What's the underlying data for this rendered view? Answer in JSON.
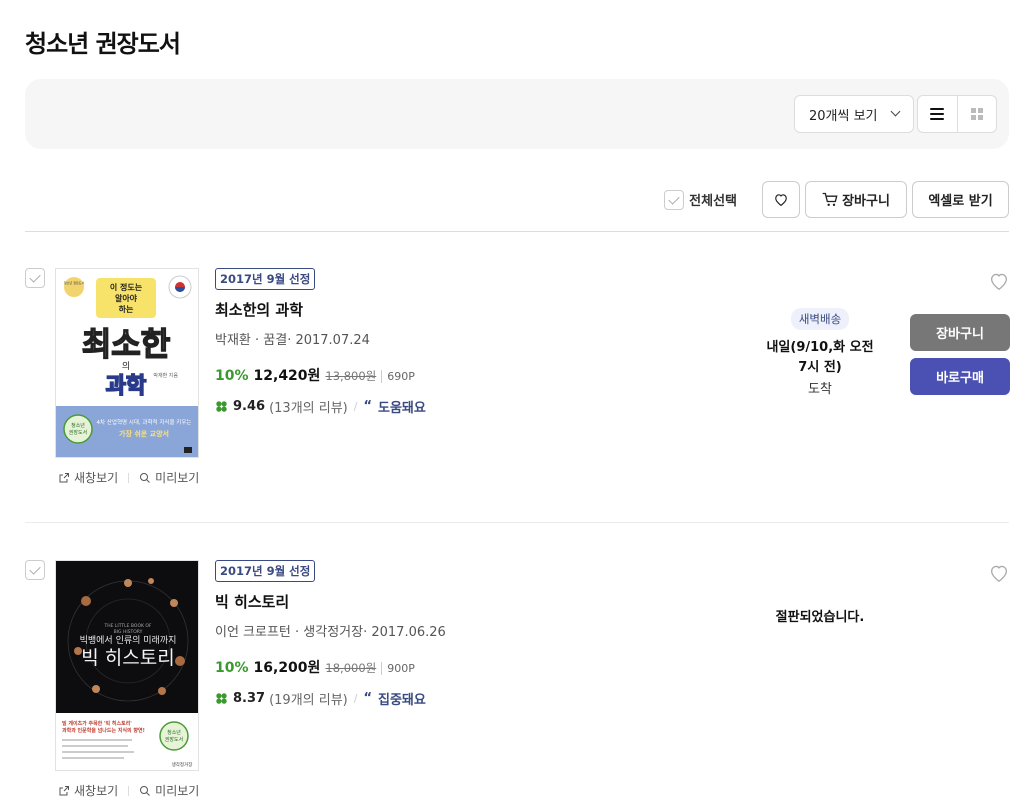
{
  "page": {
    "title": "청소년 권장도서"
  },
  "toolbar": {
    "per_page": "20개씩 보기",
    "view_list_icon": "list-view-icon",
    "view_grid_icon": "grid-view-icon"
  },
  "actions": {
    "select_all": "전체선택",
    "cart": "장바구니",
    "excel": "엑셀로 받기"
  },
  "cover_links": {
    "new_window": "새창보기",
    "preview": "미리보기"
  },
  "books": [
    {
      "badge": "2017년 9월 선정",
      "title": "최소한의 과학",
      "meta": "박재환 · 꿈결· 2017.07.24",
      "discount": "10%",
      "price": "12,420원",
      "original_price": "13,800원",
      "points": "690P",
      "score": "9.46",
      "review_count": "(13개의 리뷰)",
      "review_tag": "도움돼요",
      "delivery_badge": "새벽배송",
      "delivery_main": "내일(9/10,화 오전 7시 전)",
      "delivery_sub": "도착",
      "cart_label": "장바구니",
      "buy_label": "바로구매",
      "cover": {
        "top_text": "이 정도는 알아야 하는",
        "title_main": "최소한",
        "title_sub": "의",
        "title_end": "과학",
        "author": "박재환 지음",
        "band_text": "4차 산업혁명 시대, 과학적 지식을 키우는",
        "band_text2": "가장 쉬운 교양서",
        "seal": "청소년 권장도서",
        "small_note": "청소년 권장도서"
      }
    },
    {
      "badge": "2017년 9월 선정",
      "title": "빅 히스토리",
      "meta": "이언 크로프턴 · 생각정거장· 2017.06.26",
      "discount": "10%",
      "price": "16,200원",
      "original_price": "18,000원",
      "points": "900P",
      "score": "8.37",
      "review_count": "(19개의 리뷰)",
      "review_tag": "집중돼요",
      "status": "절판되었습니다.",
      "cover": {
        "en_title": "THE LITTLE BOOK OF BIG HISTORY",
        "subtitle": "빅뱅에서 인류의 미래까지",
        "title": "빅 히스토리",
        "blurb": "빌 게이츠가 주목한 '빅 히스토리' 과학과 인문학을 넘나드는 지식의 향연!",
        "seal": "청소년 권장도서",
        "publisher": "생각정거장"
      }
    }
  ],
  "colors": {
    "accent_blue": "#4b50b3",
    "badge_navy": "#3a4a82",
    "discount_green": "#3a9a2e",
    "cart_gray": "#777777"
  }
}
